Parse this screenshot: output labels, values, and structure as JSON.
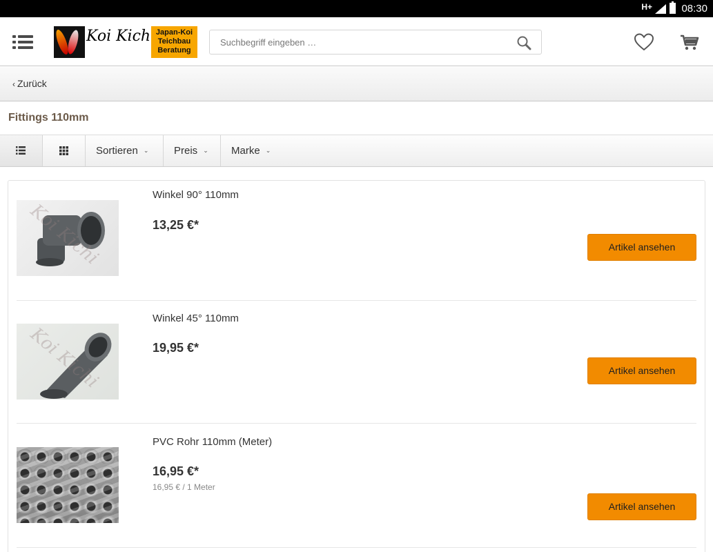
{
  "status_bar": {
    "network": "H+",
    "time": "08:30"
  },
  "header": {
    "logo": {
      "brand": "Koi Kichi",
      "tagline_1": "Japan-Koi",
      "tagline_2": "Teichbau",
      "tagline_3": "Beratung"
    },
    "search": {
      "placeholder": "Suchbegriff eingeben …"
    }
  },
  "back_bar": {
    "label": "Zurück"
  },
  "category": {
    "title": "Fittings 110mm"
  },
  "toolbar": {
    "sort_label": "Sortieren",
    "price_label": "Preis",
    "brand_label": "Marke"
  },
  "products": [
    {
      "name": "Winkel 90° 110mm",
      "price": "13,25 €*",
      "unit_price": "",
      "button": "Artikel ansehen",
      "image": "pvc-elbow-90"
    },
    {
      "name": "Winkel 45° 110mm",
      "price": "19,95 €*",
      "unit_price": "",
      "button": "Artikel ansehen",
      "image": "pvc-elbow-45"
    },
    {
      "name": "PVC Rohr 110mm (Meter)",
      "price": "16,95 €*",
      "unit_price": "16,95 € / 1 Meter",
      "button": "Artikel ansehen",
      "image": "pvc-pipes"
    }
  ],
  "colors": {
    "accent": "#f28b00",
    "title": "#6b5a49",
    "logo_orange": "#f7a600"
  }
}
